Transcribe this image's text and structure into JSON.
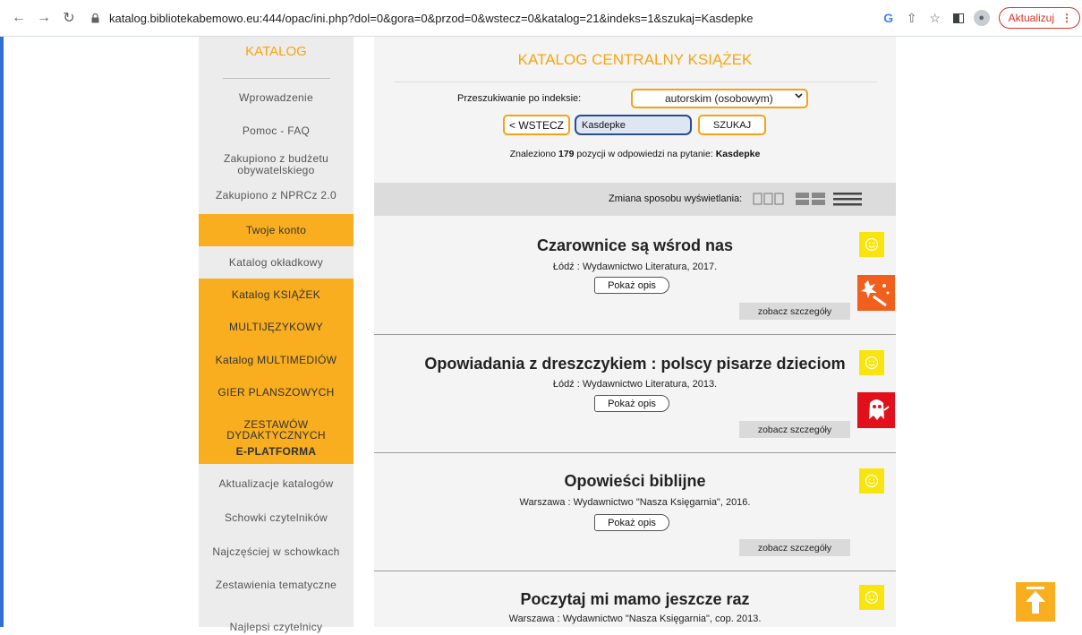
{
  "browser": {
    "url": "katalog.bibliotekabemowo.eu:444/opac/ini.php?dol=0&gora=0&przod=0&wstecz=0&katalog=21&indeks=1&szukaj=Kasdepke",
    "update_label": "Aktualizuj"
  },
  "sidebar": {
    "title": "KATALOG",
    "items": [
      {
        "label": "Wprowadzenie"
      },
      {
        "label": "Pomoc - FAQ"
      },
      {
        "label": "Zakupiono z budżetu obywatelskiego"
      },
      {
        "label": "Zakupiono z NPRCz 2.0"
      },
      {
        "label": "Twoje konto"
      },
      {
        "label": "Katalog okładkowy"
      },
      {
        "label": "Katalog KSIĄŻEK"
      },
      {
        "label": "MULTIJĘZYKOWY"
      },
      {
        "label": "Katalog MULTIMEDIÓW"
      },
      {
        "label": "GIER PLANSZOWYCH"
      },
      {
        "label": "ZESTAWÓW DYDAKTYCZNYCH"
      },
      {
        "label": "E-PLATFORMA"
      },
      {
        "label": "Aktualizacje katalogów"
      },
      {
        "label": "Schowki czytelników"
      },
      {
        "label": "Najczęściej w schowkach"
      },
      {
        "label": "Zestawienia tematyczne"
      },
      {
        "label": "Najlepsi czytelnicy"
      }
    ]
  },
  "main": {
    "title": "KATALOG CENTRALNY KSIĄŻEK",
    "index_label": "Przeszukiwanie po indeksie:",
    "index_value": "autorskim (osobowym)",
    "back_label": "< WSTECZ",
    "search_value": "Kasdepke",
    "search_label": "SZUKAJ",
    "found_prefix": "Znaleziono ",
    "found_count": "179",
    "found_mid": " pozycji w odpowiedzi na pytanie: ",
    "found_query": "Kasdepke",
    "view_label": "Zmiana sposobu wyświetlania:"
  },
  "results": [
    {
      "title": "Czarownice są wśrod nas",
      "publisher": "Łódź : Wydawnictwo Literatura, 2017.",
      "show_label": "Pokaż opis",
      "details_label": "zobacz szczegóły"
    },
    {
      "title": "Opowiadania z dreszczykiem : polscy pisarze dzieciom",
      "publisher": "Łódź : Wydawnictwo Literatura, 2013.",
      "show_label": "Pokaż opis",
      "details_label": "zobacz szczegóły"
    },
    {
      "title": "Opowieści biblijne",
      "publisher": "Warszawa : Wydawnictwo \"Nasza Księgarnia\", 2016.",
      "show_label": "Pokaż opis",
      "details_label": "zobacz szczegóły"
    },
    {
      "title": "Poczytaj mi mamo jeszcze raz",
      "publisher": "Warszawa : Wydawnictwo \"Nasza Księgarnia\", cop. 2013."
    }
  ],
  "colors": {
    "accent": "#f8ae1f",
    "title_orange": "#f7a50f",
    "smile_yellow": "#f8e50f"
  }
}
